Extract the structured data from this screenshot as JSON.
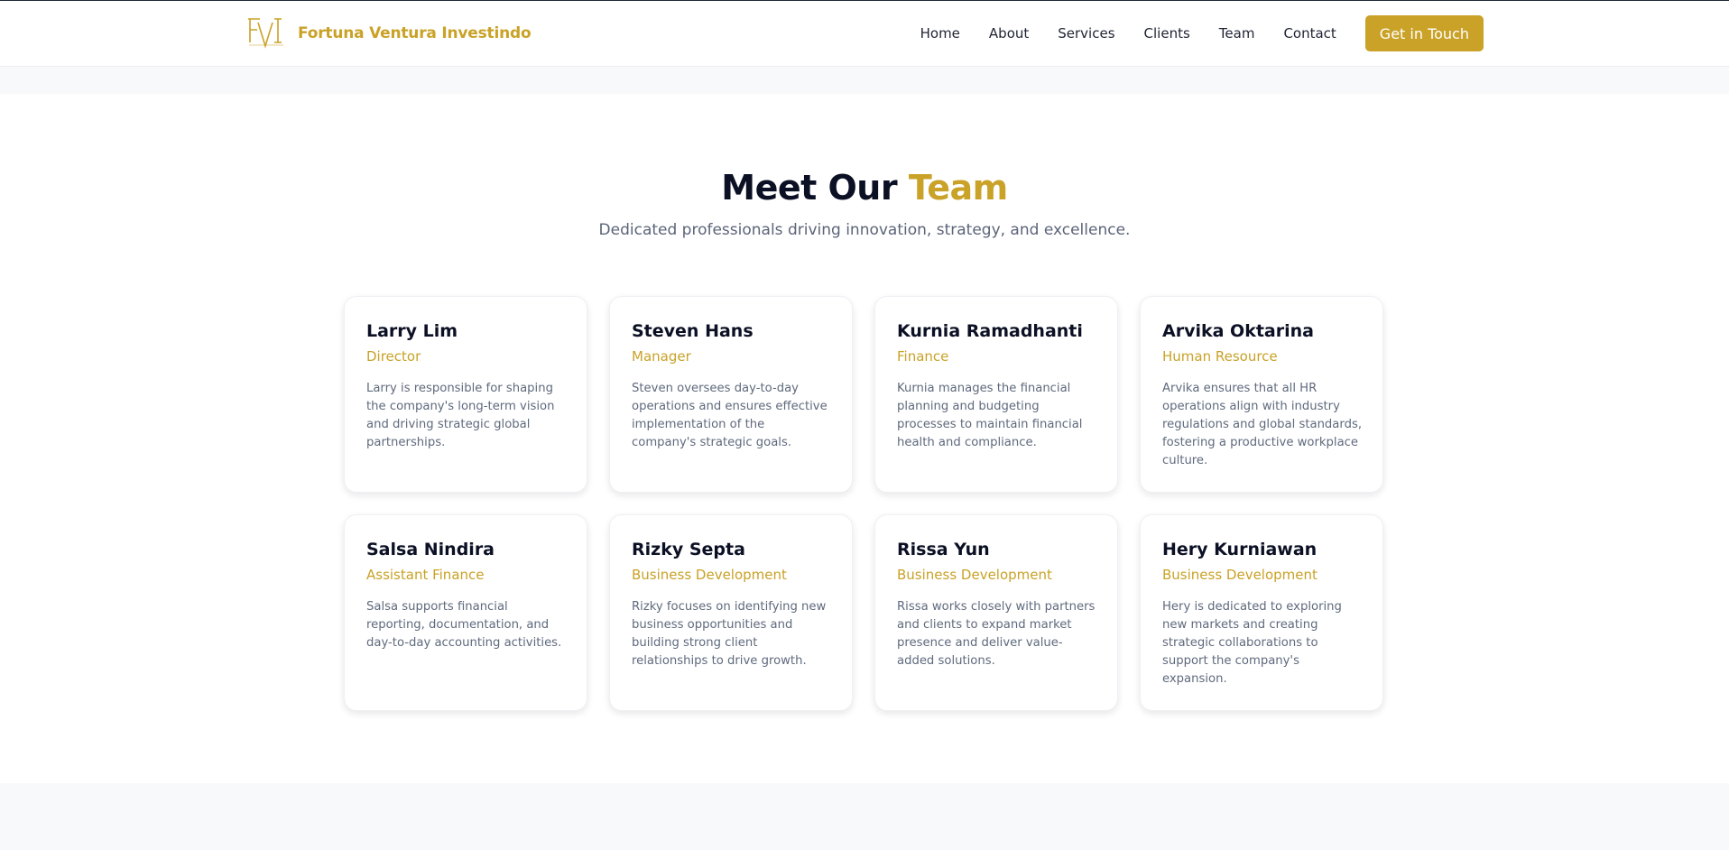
{
  "header": {
    "brand_name": "Fortuna Ventura Investindo",
    "logo_icon": "fvi-logo-icon",
    "nav": [
      {
        "label": "Home"
      },
      {
        "label": "About"
      },
      {
        "label": "Services"
      },
      {
        "label": "Clients"
      },
      {
        "label": "Team"
      },
      {
        "label": "Contact"
      }
    ],
    "cta_label": "Get in Touch"
  },
  "team": {
    "title_prefix": "Meet Our",
    "title_accent": "Team",
    "subtitle": "Dedicated professionals driving innovation, strategy, and excellence.",
    "members": [
      {
        "name": "Larry Lim",
        "role": "Director",
        "bio": "Larry is responsible for shaping the company's long-term vision and driving strategic global partnerships."
      },
      {
        "name": "Steven Hans",
        "role": "Manager",
        "bio": "Steven oversees day-to-day operations and ensures effective implementation of the company's strategic goals."
      },
      {
        "name": "Kurnia Ramadhanti",
        "role": "Finance",
        "bio": "Kurnia manages the financial planning and budgeting processes to maintain financial health and compliance."
      },
      {
        "name": "Arvika Oktarina",
        "role": "Human Resource",
        "bio": "Arvika ensures that all HR operations align with industry regulations and global standards, fostering a productive workplace culture."
      },
      {
        "name": "Salsa Nindira",
        "role": "Assistant Finance",
        "bio": "Salsa supports financial reporting, documentation, and day-to-day accounting activities."
      },
      {
        "name": "Rizky Septa",
        "role": "Business Development",
        "bio": "Rizky focuses on identifying new business opportunities and building strong client relationships to drive growth."
      },
      {
        "name": "Rissa Yun",
        "role": "Business Development",
        "bio": "Rissa works closely with partners and clients to expand market presence and deliver value-added solutions."
      },
      {
        "name": "Hery Kurniawan",
        "role": "Business Development",
        "bio": "Hery is dedicated to exploring new markets and creating strategic collaborations to support the company's expansion."
      }
    ]
  },
  "colors": {
    "accent": "#c9a227",
    "heading": "#0b1024",
    "body_text": "#5f6a7d",
    "page_background": "#f8f9fb"
  }
}
